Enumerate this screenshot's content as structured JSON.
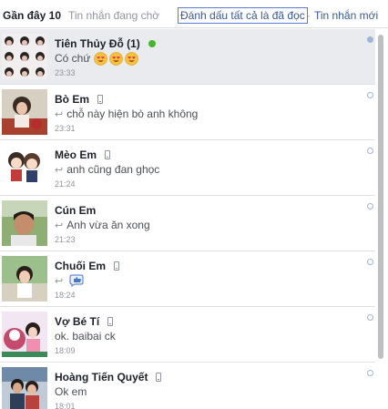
{
  "header": {
    "recent_label": "Gần đây 10",
    "pending_label": "Tin nhắn đang chờ",
    "mark_all_read_label": "Đánh dấu tất cả là đã đọc",
    "separator": "·",
    "new_message_label": "Tin nhắn mới"
  },
  "conversations": [
    {
      "name": "Tiên Thủy Đỗ (1)",
      "snippet": "Có chứ",
      "time": "23:33",
      "status": "online",
      "unread": true,
      "emoji": [
        "heart-eyes",
        "heart-eyes",
        "heart-eyes"
      ]
    },
    {
      "name": "Bò Em",
      "snippet": "chỗ này hiện bò anh không",
      "time": "23:31",
      "status": "mobile",
      "replied": true
    },
    {
      "name": "Mèo Em",
      "snippet": "anh cũng đan ghọc",
      "time": "21:24",
      "status": "mobile",
      "replied": true
    },
    {
      "name": "Cún Em",
      "snippet": "Anh vừa ăn xong",
      "time": "21:23",
      "status": "none",
      "replied": true
    },
    {
      "name": "Chuối Em",
      "snippet": "",
      "time": "18:24",
      "status": "mobile",
      "replied": true,
      "sticker": "like-bubble"
    },
    {
      "name": "Vợ Bé Tí",
      "snippet": "ok. baibai ck",
      "time": "18:09",
      "status": "mobile"
    },
    {
      "name": "Hoàng Tiến Quyết",
      "snippet": "Ok em",
      "time": "18:01",
      "status": "mobile"
    }
  ],
  "colors": {
    "link": "#365899",
    "unread_bg": "#e9ebee",
    "online": "#42b72a",
    "muted": "#90949c"
  }
}
